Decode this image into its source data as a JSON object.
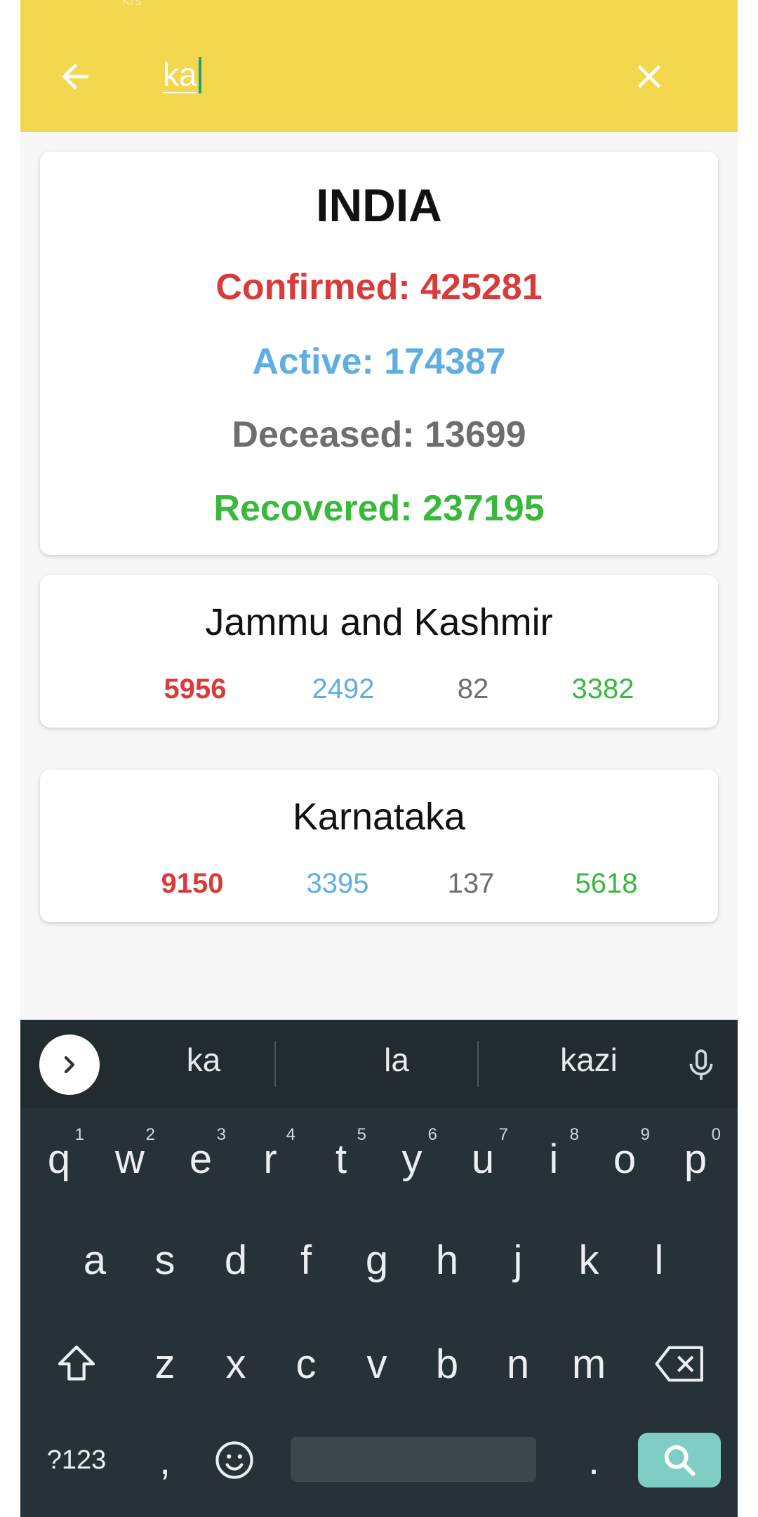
{
  "status_bar": {
    "ghost_text": "K/s"
  },
  "search": {
    "query": "ka"
  },
  "icons": {
    "back": "arrow-left-icon",
    "clear": "close-icon",
    "expand": "chevron-right-icon",
    "mic": "microphone-icon",
    "shift": "shift-icon",
    "backspace": "backspace-icon",
    "emoji": "emoji-icon",
    "search": "search-icon"
  },
  "colors": {
    "appbar": "#f2d74f",
    "confirmed": "#d93b3b",
    "active": "#5faee3",
    "deceased": "#6e6e6e",
    "recovered": "#39b93c"
  },
  "india": {
    "title": "INDIA",
    "confirmed": "Confirmed: 425281",
    "active": "Active: 174387",
    "deceased": "Deceased: 13699",
    "recovered": "Recovered: 237195"
  },
  "states": [
    {
      "name": "Jammu and Kashmir",
      "confirmed": "5956",
      "active": "2492",
      "deceased": "82",
      "recovered": "3382"
    },
    {
      "name": "Karnataka",
      "confirmed": "9150",
      "active": "3395",
      "deceased": "137",
      "recovered": "5618"
    }
  ],
  "keyboard": {
    "suggestions": [
      "ka",
      "la",
      "kazi"
    ],
    "row1": [
      "q",
      "w",
      "e",
      "r",
      "t",
      "y",
      "u",
      "i",
      "o",
      "p"
    ],
    "row1_hints": [
      "1",
      "2",
      "3",
      "4",
      "5",
      "6",
      "7",
      "8",
      "9",
      "0"
    ],
    "row2": [
      "a",
      "s",
      "d",
      "f",
      "g",
      "h",
      "j",
      "k",
      "l"
    ],
    "row3": [
      "z",
      "x",
      "c",
      "v",
      "b",
      "n",
      "m"
    ],
    "symbols_label": "?123",
    "comma": ",",
    "period": "."
  }
}
